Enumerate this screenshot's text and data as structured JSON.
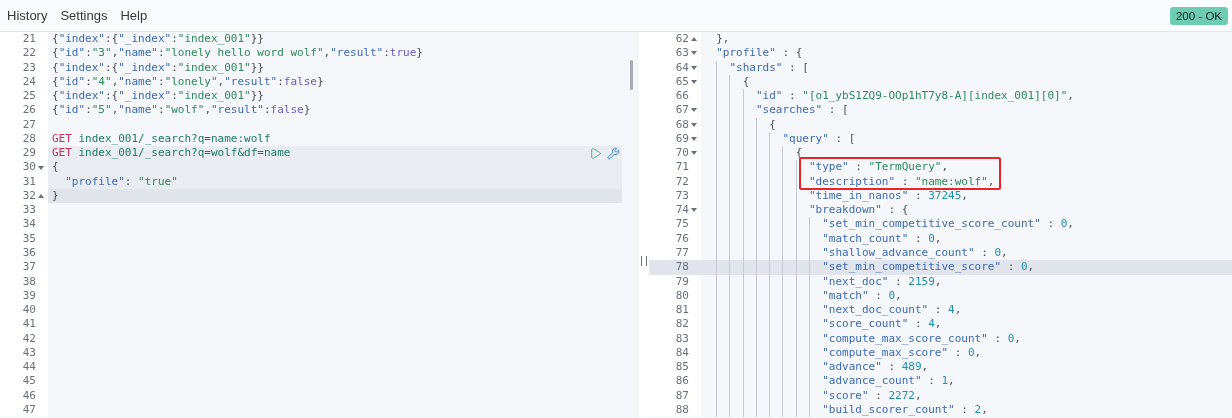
{
  "menu": [
    {
      "label": "History"
    },
    {
      "label": "Settings"
    },
    {
      "label": "Help"
    }
  ],
  "status": {
    "text": "200 - OK",
    "kind": "success"
  },
  "request": {
    "lines": [
      {
        "number": "21",
        "tokens": [
          {
            "kind": "punct",
            "text": "{"
          },
          {
            "kind": "key",
            "text": "\"index\""
          },
          {
            "kind": "punct",
            "text": ":{"
          },
          {
            "kind": "key",
            "text": "\"_index\""
          },
          {
            "kind": "punct",
            "text": ":"
          },
          {
            "kind": "string",
            "text": "\"index_001\""
          },
          {
            "kind": "punct",
            "text": "}}"
          }
        ]
      },
      {
        "number": "22",
        "tokens": [
          {
            "kind": "punct",
            "text": "{"
          },
          {
            "kind": "key",
            "text": "\"id\""
          },
          {
            "kind": "punct",
            "text": ":"
          },
          {
            "kind": "string",
            "text": "\"3\""
          },
          {
            "kind": "punct",
            "text": ","
          },
          {
            "kind": "key",
            "text": "\"name\""
          },
          {
            "kind": "punct",
            "text": ":"
          },
          {
            "kind": "string",
            "text": "\"lonely hello word wolf\""
          },
          {
            "kind": "punct",
            "text": ","
          },
          {
            "kind": "key",
            "text": "\"result\""
          },
          {
            "kind": "punct",
            "text": ":"
          },
          {
            "kind": "bool",
            "text": "true"
          },
          {
            "kind": "punct",
            "text": "}"
          }
        ]
      },
      {
        "number": "23",
        "tokens": [
          {
            "kind": "punct",
            "text": "{"
          },
          {
            "kind": "key",
            "text": "\"index\""
          },
          {
            "kind": "punct",
            "text": ":{"
          },
          {
            "kind": "key",
            "text": "\"_index\""
          },
          {
            "kind": "punct",
            "text": ":"
          },
          {
            "kind": "string",
            "text": "\"index_001\""
          },
          {
            "kind": "punct",
            "text": "}}"
          }
        ]
      },
      {
        "number": "24",
        "tokens": [
          {
            "kind": "punct",
            "text": "{"
          },
          {
            "kind": "key",
            "text": "\"id\""
          },
          {
            "kind": "punct",
            "text": ":"
          },
          {
            "kind": "string",
            "text": "\"4\""
          },
          {
            "kind": "punct",
            "text": ","
          },
          {
            "kind": "key",
            "text": "\"name\""
          },
          {
            "kind": "punct",
            "text": ":"
          },
          {
            "kind": "string",
            "text": "\"lonely\""
          },
          {
            "kind": "punct",
            "text": ","
          },
          {
            "kind": "key",
            "text": "\"result\""
          },
          {
            "kind": "punct",
            "text": ":"
          },
          {
            "kind": "bool",
            "text": "false"
          },
          {
            "kind": "punct",
            "text": "}"
          }
        ]
      },
      {
        "number": "25",
        "tokens": [
          {
            "kind": "punct",
            "text": "{"
          },
          {
            "kind": "key",
            "text": "\"index\""
          },
          {
            "kind": "punct",
            "text": ":{"
          },
          {
            "kind": "key",
            "text": "\"_index\""
          },
          {
            "kind": "punct",
            "text": ":"
          },
          {
            "kind": "string",
            "text": "\"index_001\""
          },
          {
            "kind": "punct",
            "text": "}}"
          }
        ]
      },
      {
        "number": "26",
        "tokens": [
          {
            "kind": "punct",
            "text": "{"
          },
          {
            "kind": "key",
            "text": "\"id\""
          },
          {
            "kind": "punct",
            "text": ":"
          },
          {
            "kind": "string",
            "text": "\"5\""
          },
          {
            "kind": "punct",
            "text": ","
          },
          {
            "kind": "key",
            "text": "\"name\""
          },
          {
            "kind": "punct",
            "text": ":"
          },
          {
            "kind": "string",
            "text": "\"wolf\""
          },
          {
            "kind": "punct",
            "text": ","
          },
          {
            "kind": "key",
            "text": "\"result\""
          },
          {
            "kind": "punct",
            "text": ":"
          },
          {
            "kind": "bool",
            "text": "false"
          },
          {
            "kind": "punct",
            "text": "}"
          }
        ]
      },
      {
        "number": "27"
      },
      {
        "number": "28",
        "tokens": [
          {
            "kind": "method",
            "text": "GET"
          },
          {
            "kind": "url",
            "text": "index_001/_search?q=name:wolf"
          }
        ]
      },
      {
        "number": "29",
        "in_request": true,
        "actions": true,
        "tokens": [
          {
            "kind": "method",
            "text": "GET"
          },
          {
            "kind": "url",
            "text": "index_001/_search?q=wolf&df=name"
          }
        ]
      },
      {
        "number": "30",
        "in_request": true,
        "fold_start": true,
        "tokens": [
          {
            "kind": "punct",
            "text": "{"
          }
        ]
      },
      {
        "number": "31",
        "in_request": true,
        "tokens": [
          {
            "kind": "key",
            "text": "  \"profile\""
          },
          {
            "kind": "punct",
            "text": ": "
          },
          {
            "kind": "string",
            "text": "\"true\""
          }
        ]
      },
      {
        "number": "32",
        "current": true,
        "fold_end": true,
        "tokens": [
          {
            "kind": "punct",
            "text": "}"
          }
        ]
      },
      {
        "number": "33"
      },
      {
        "number": "34"
      },
      {
        "number": "35"
      },
      {
        "number": "36"
      },
      {
        "number": "37"
      },
      {
        "number": "38"
      },
      {
        "number": "39"
      },
      {
        "number": "40"
      },
      {
        "number": "41"
      },
      {
        "number": "42"
      },
      {
        "number": "43"
      },
      {
        "number": "44"
      },
      {
        "number": "45"
      },
      {
        "number": "46"
      },
      {
        "number": "47"
      }
    ]
  },
  "response": {
    "lines": [
      {
        "number": "62",
        "fold_end": true,
        "tokens": [
          {
            "kind": "punct",
            "text": "  },"
          }
        ]
      },
      {
        "number": "63",
        "fold_start": true,
        "tokens": [
          {
            "kind": "key",
            "text": "  \"profile\""
          },
          {
            "kind": "punct",
            "text": " : {"
          }
        ]
      },
      {
        "number": "64",
        "fold_start": true,
        "tokens": [
          {
            "kind": "key",
            "text": "    \"shards\""
          },
          {
            "kind": "punct",
            "text": " : ["
          }
        ]
      },
      {
        "number": "65",
        "fold_start": true,
        "tokens": [
          {
            "kind": "punct",
            "text": "      {"
          }
        ]
      },
      {
        "number": "66",
        "tokens": [
          {
            "kind": "key",
            "text": "        \"id\""
          },
          {
            "kind": "punct",
            "text": " : "
          },
          {
            "kind": "string",
            "text": "\"[o1_ybS1ZQ9-OOp1hT7y8-A][index_001][0]\""
          },
          {
            "kind": "punct",
            "text": ","
          }
        ]
      },
      {
        "number": "67",
        "fold_start": true,
        "tokens": [
          {
            "kind": "key",
            "text": "        \"searches\""
          },
          {
            "kind": "punct",
            "text": " : ["
          }
        ]
      },
      {
        "number": "68",
        "fold_start": true,
        "tokens": [
          {
            "kind": "punct",
            "text": "          {"
          }
        ]
      },
      {
        "number": "69",
        "fold_start": true,
        "tokens": [
          {
            "kind": "key",
            "text": "            \"query\""
          },
          {
            "kind": "punct",
            "text": " : ["
          }
        ]
      },
      {
        "number": "70",
        "fold_start": true,
        "tokens": [
          {
            "kind": "punct",
            "text": "              {"
          }
        ]
      },
      {
        "number": "71",
        "boxed": true,
        "tokens": [
          {
            "kind": "key",
            "text": "                \"type\""
          },
          {
            "kind": "punct",
            "text": " : "
          },
          {
            "kind": "string",
            "text": "\"TermQuery\""
          },
          {
            "kind": "punct",
            "text": ","
          }
        ]
      },
      {
        "number": "72",
        "boxed": true,
        "tokens": [
          {
            "kind": "key",
            "text": "                \"description\""
          },
          {
            "kind": "punct",
            "text": " : "
          },
          {
            "kind": "string",
            "text": "\"name:wolf\""
          },
          {
            "kind": "punct",
            "text": ","
          }
        ]
      },
      {
        "number": "73",
        "tokens": [
          {
            "kind": "key",
            "text": "                \"time_in_nanos\""
          },
          {
            "kind": "punct",
            "text": " : "
          },
          {
            "kind": "number",
            "text": "37245"
          },
          {
            "kind": "punct",
            "text": ","
          }
        ]
      },
      {
        "number": "74",
        "fold_start": true,
        "tokens": [
          {
            "kind": "key",
            "text": "                \"breakdown\""
          },
          {
            "kind": "punct",
            "text": " : {"
          }
        ]
      },
      {
        "number": "75",
        "tokens": [
          {
            "kind": "key",
            "text": "                  \"set_min_competitive_score_count\""
          },
          {
            "kind": "punct",
            "text": " : "
          },
          {
            "kind": "number",
            "text": "0"
          },
          {
            "kind": "punct",
            "text": ","
          }
        ]
      },
      {
        "number": "76",
        "tokens": [
          {
            "kind": "key",
            "text": "                  \"match_count\""
          },
          {
            "kind": "punct",
            "text": " : "
          },
          {
            "kind": "number",
            "text": "0"
          },
          {
            "kind": "punct",
            "text": ","
          }
        ]
      },
      {
        "number": "77",
        "tokens": [
          {
            "kind": "key",
            "text": "                  \"shallow_advance_count\""
          },
          {
            "kind": "punct",
            "text": " : "
          },
          {
            "kind": "number",
            "text": "0"
          },
          {
            "kind": "punct",
            "text": ","
          }
        ]
      },
      {
        "number": "78",
        "current": true,
        "tokens": [
          {
            "kind": "key",
            "text": "                  \"set_min_competitive_score\""
          },
          {
            "kind": "punct",
            "text": " : "
          },
          {
            "kind": "number",
            "text": "0"
          },
          {
            "kind": "punct",
            "text": ","
          }
        ]
      },
      {
        "number": "79",
        "tokens": [
          {
            "kind": "key",
            "text": "                  \"next_doc\""
          },
          {
            "kind": "punct",
            "text": " : "
          },
          {
            "kind": "number",
            "text": "2159"
          },
          {
            "kind": "punct",
            "text": ","
          }
        ]
      },
      {
        "number": "80",
        "tokens": [
          {
            "kind": "key",
            "text": "                  \"match\""
          },
          {
            "kind": "punct",
            "text": " : "
          },
          {
            "kind": "number",
            "text": "0"
          },
          {
            "kind": "punct",
            "text": ","
          }
        ]
      },
      {
        "number": "81",
        "tokens": [
          {
            "kind": "key",
            "text": "                  \"next_doc_count\""
          },
          {
            "kind": "punct",
            "text": " : "
          },
          {
            "kind": "number",
            "text": "4"
          },
          {
            "kind": "punct",
            "text": ","
          }
        ]
      },
      {
        "number": "82",
        "tokens": [
          {
            "kind": "key",
            "text": "                  \"score_count\""
          },
          {
            "kind": "punct",
            "text": " : "
          },
          {
            "kind": "number",
            "text": "4"
          },
          {
            "kind": "punct",
            "text": ","
          }
        ]
      },
      {
        "number": "83",
        "tokens": [
          {
            "kind": "key",
            "text": "                  \"compute_max_score_count\""
          },
          {
            "kind": "punct",
            "text": " : "
          },
          {
            "kind": "number",
            "text": "0"
          },
          {
            "kind": "punct",
            "text": ","
          }
        ]
      },
      {
        "number": "84",
        "tokens": [
          {
            "kind": "key",
            "text": "                  \"compute_max_score\""
          },
          {
            "kind": "punct",
            "text": " : "
          },
          {
            "kind": "number",
            "text": "0"
          },
          {
            "kind": "punct",
            "text": ","
          }
        ]
      },
      {
        "number": "85",
        "tokens": [
          {
            "kind": "key",
            "text": "                  \"advance\""
          },
          {
            "kind": "punct",
            "text": " : "
          },
          {
            "kind": "number",
            "text": "489"
          },
          {
            "kind": "punct",
            "text": ","
          }
        ]
      },
      {
        "number": "86",
        "tokens": [
          {
            "kind": "key",
            "text": "                  \"advance_count\""
          },
          {
            "kind": "punct",
            "text": " : "
          },
          {
            "kind": "number",
            "text": "1"
          },
          {
            "kind": "punct",
            "text": ","
          }
        ]
      },
      {
        "number": "87",
        "tokens": [
          {
            "kind": "key",
            "text": "                  \"score\""
          },
          {
            "kind": "punct",
            "text": " : "
          },
          {
            "kind": "number",
            "text": "2272"
          },
          {
            "kind": "punct",
            "text": ","
          }
        ]
      },
      {
        "number": "88",
        "tokens": [
          {
            "kind": "key",
            "text": "                  \"build_scorer_count\""
          },
          {
            "kind": "punct",
            "text": " : "
          },
          {
            "kind": "number",
            "text": "2"
          },
          {
            "kind": "punct",
            "text": ","
          }
        ]
      }
    ]
  }
}
